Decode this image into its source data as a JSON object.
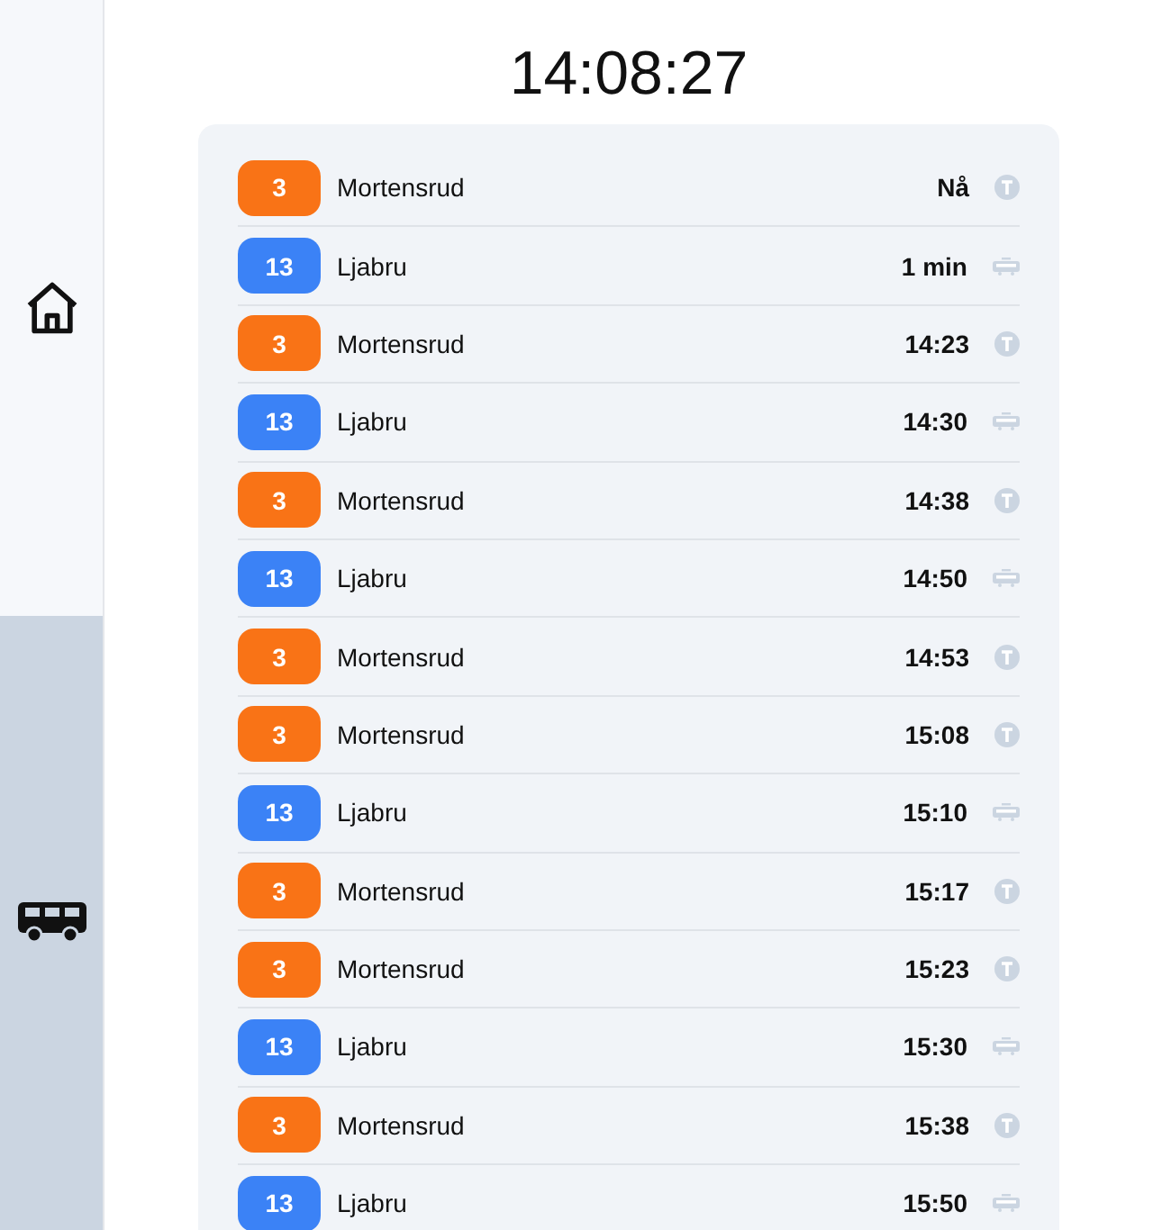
{
  "sidebar": {
    "items": [
      {
        "kind": "home",
        "selected": false
      },
      {
        "kind": "bus",
        "selected": true
      }
    ]
  },
  "clock": "14:08:27",
  "departures": [
    {
      "line": "3",
      "color": "#f97316",
      "destination": "Mortensrud",
      "time": "Nå",
      "kind": "metro"
    },
    {
      "line": "13",
      "color": "#3b82f6",
      "destination": "Ljabru",
      "time": "1 min",
      "kind": "tram"
    },
    {
      "line": "3",
      "color": "#f97316",
      "destination": "Mortensrud",
      "time": "14:23",
      "kind": "metro"
    },
    {
      "line": "13",
      "color": "#3b82f6",
      "destination": "Ljabru",
      "time": "14:30",
      "kind": "tram"
    },
    {
      "line": "3",
      "color": "#f97316",
      "destination": "Mortensrud",
      "time": "14:38",
      "kind": "metro"
    },
    {
      "line": "13",
      "color": "#3b82f6",
      "destination": "Ljabru",
      "time": "14:50",
      "kind": "tram"
    },
    {
      "line": "3",
      "color": "#f97316",
      "destination": "Mortensrud",
      "time": "14:53",
      "kind": "metro"
    },
    {
      "line": "3",
      "color": "#f97316",
      "destination": "Mortensrud",
      "time": "15:08",
      "kind": "metro"
    },
    {
      "line": "13",
      "color": "#3b82f6",
      "destination": "Ljabru",
      "time": "15:10",
      "kind": "tram"
    },
    {
      "line": "3",
      "color": "#f97316",
      "destination": "Mortensrud",
      "time": "15:17",
      "kind": "metro"
    },
    {
      "line": "3",
      "color": "#f97316",
      "destination": "Mortensrud",
      "time": "15:23",
      "kind": "metro"
    },
    {
      "line": "13",
      "color": "#3b82f6",
      "destination": "Ljabru",
      "time": "15:30",
      "kind": "tram"
    },
    {
      "line": "3",
      "color": "#f97316",
      "destination": "Mortensrud",
      "time": "15:38",
      "kind": "metro"
    },
    {
      "line": "13",
      "color": "#3b82f6",
      "destination": "Ljabru",
      "time": "15:50",
      "kind": "tram"
    }
  ]
}
